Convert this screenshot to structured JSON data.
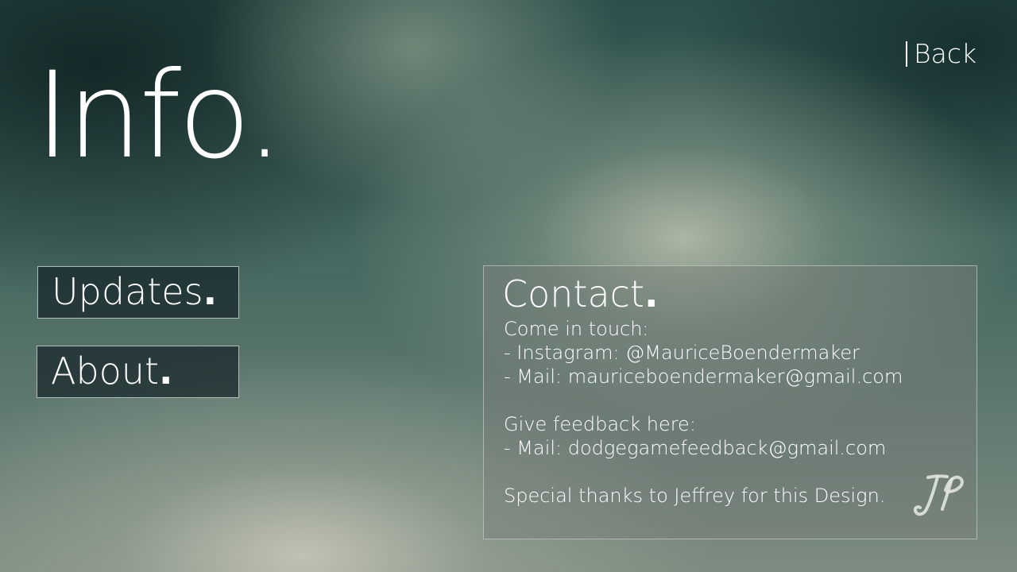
{
  "header": {
    "back_label": "Back",
    "title": "Info."
  },
  "nav": {
    "updates_label": "Updates",
    "about_label": "About",
    "dot": "."
  },
  "contact": {
    "title": "Contact",
    "dot": ".",
    "lines": [
      "Come in touch:",
      "- Instagram: @MauriceBoendermaker",
      "- Mail: mauriceboendermaker@gmail.com",
      "",
      "Give feedback here:",
      "- Mail: dodgegamefeedback@gmail.com",
      "",
      "Special thanks to Jeffrey for this Design."
    ],
    "signature_logo": "JP"
  }
}
